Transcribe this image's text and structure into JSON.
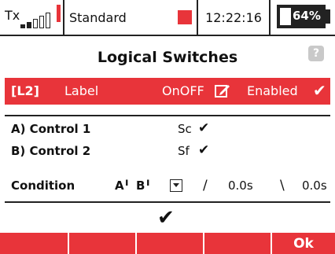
{
  "status": {
    "tx_label": "Tx",
    "model": "Standard",
    "time": "12:22:16",
    "battery": "64%",
    "battery_level": 0.64,
    "accent_color": "#e8343a"
  },
  "screen": {
    "title": "Logical Switches",
    "help_icon": "?"
  },
  "switch": {
    "id": "[L2]",
    "label": "Label",
    "mode": "OnOFF",
    "enabled": "Enabled",
    "enabled_check": "✔",
    "edit_icon": "edit-icon"
  },
  "controls": {
    "control1_label": "A) Control 1",
    "control1_value": "Sc",
    "control1_check": "✔",
    "control2_label": "B) Control 2",
    "control2_value": "Sf",
    "control2_check": "✔"
  },
  "condition": {
    "label": "Condition",
    "expr_a": "A",
    "expr_a_mark": "ı",
    "expr_b": "B",
    "expr_b_mark": "ı",
    "rise_symbol": "/",
    "rise_delay": "0.0s",
    "fall_symbol": "\\",
    "fall_delay": "0.0s"
  },
  "result_check": "✔",
  "softkeys": [
    "",
    "",
    "",
    "",
    "Ok"
  ]
}
